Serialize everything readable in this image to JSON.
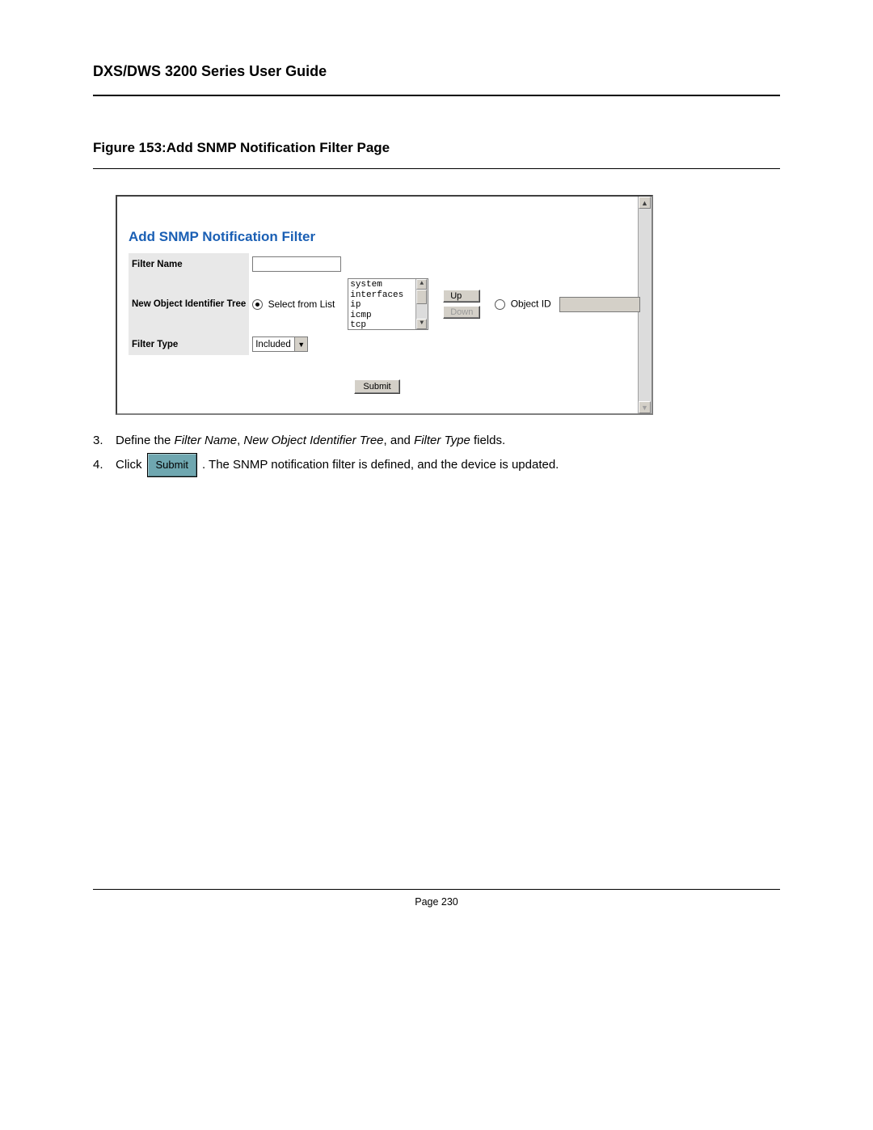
{
  "header": {
    "title": "DXS/DWS 3200 Series User Guide"
  },
  "figure": {
    "caption": "Figure 153:Add SNMP Notification Filter Page"
  },
  "panel": {
    "title": "Add SNMP Notification Filter",
    "fields": {
      "filter_name_label": "Filter Name",
      "tree_label": "New Object Identifier Tree",
      "select_from_list_label": "Select from List",
      "listbox": [
        "system",
        "interfaces",
        "ip",
        "icmp",
        "tcp"
      ],
      "up_label": "Up",
      "down_label": "Down",
      "object_id_label": "Object ID",
      "filter_type_label": "Filter Type",
      "filter_type_value": "Included"
    },
    "submit_label": "Submit"
  },
  "instructions": {
    "item3_num": "3.",
    "item3_a": "Define the ",
    "item3_i1": "Filter Name",
    "item3_b": ", ",
    "item3_i2": "New Object Identifier Tree",
    "item3_c": ", and ",
    "item3_i3": "Filter Type",
    "item3_d": " fields.",
    "item4_num": "4.",
    "item4_a": "Click",
    "item4_btn": "Submit",
    "item4_b": ". The SNMP notification filter is defined, and the device is updated."
  },
  "footer": {
    "page": "Page 230"
  }
}
